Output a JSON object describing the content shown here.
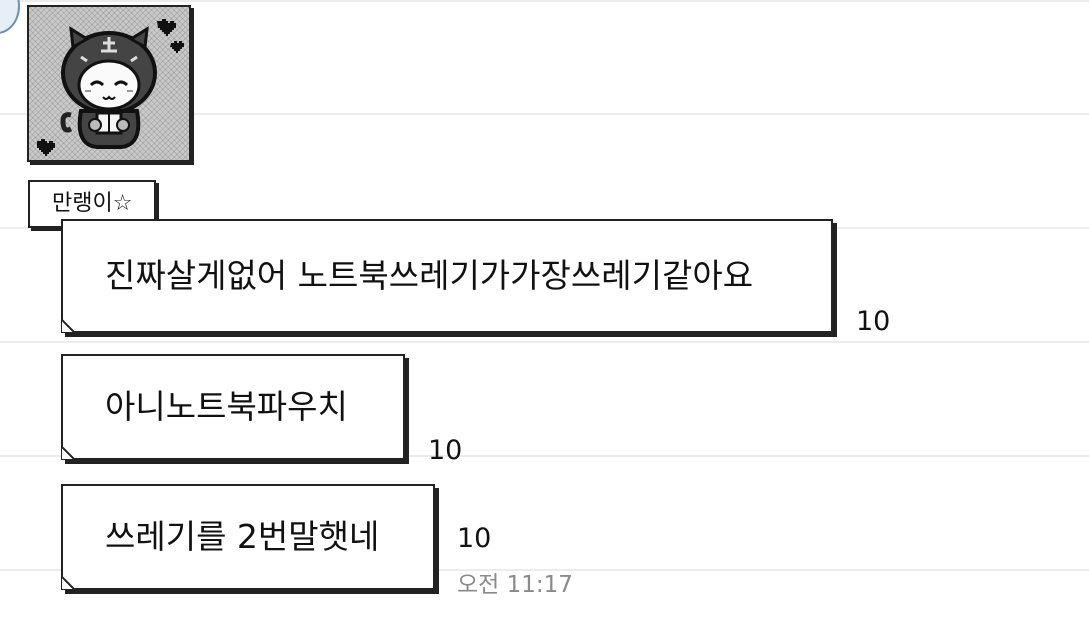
{
  "chat": {
    "sender_name": "만랭이☆",
    "messages": [
      {
        "text": "진짜살게없어 노트북쓰레기가가장쓰레기같아요",
        "count": "10"
      },
      {
        "text": "아니노트북파우치",
        "count": "10"
      },
      {
        "text": "쓰레기를 2번말햇네",
        "count": "10",
        "time": "오전 11:17"
      }
    ]
  }
}
